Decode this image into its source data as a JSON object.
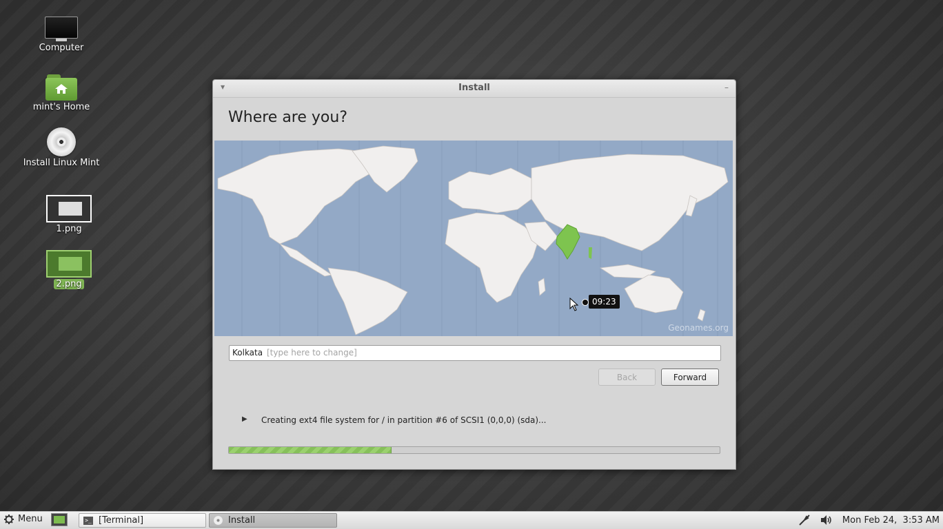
{
  "desktop": {
    "icons": [
      {
        "label": "Computer"
      },
      {
        "label": "mint's Home"
      },
      {
        "label": "Install Linux Mint"
      },
      {
        "label": "1.png"
      },
      {
        "label": "2.png"
      }
    ]
  },
  "window": {
    "title": "Install",
    "heading": "Where are you?",
    "map": {
      "credit": "Geonames.org",
      "timezone_time": "09:23",
      "highlight_color": "#7ec44f",
      "ocean_color": "#93a9c6"
    },
    "city_input": {
      "value": "Kolkata",
      "placeholder": "[type here to change]"
    },
    "buttons": {
      "back": "Back",
      "forward": "Forward"
    },
    "status_text": "Creating ext4 file system for / in partition #6 of SCSI1 (0,0,0) (sda)...",
    "progress_percent": 33
  },
  "taskbar": {
    "menu_label": "Menu",
    "windows": [
      {
        "label": "[Terminal]"
      },
      {
        "label": "Install"
      }
    ],
    "clock": "Mon Feb 24,  3:53 AM"
  }
}
